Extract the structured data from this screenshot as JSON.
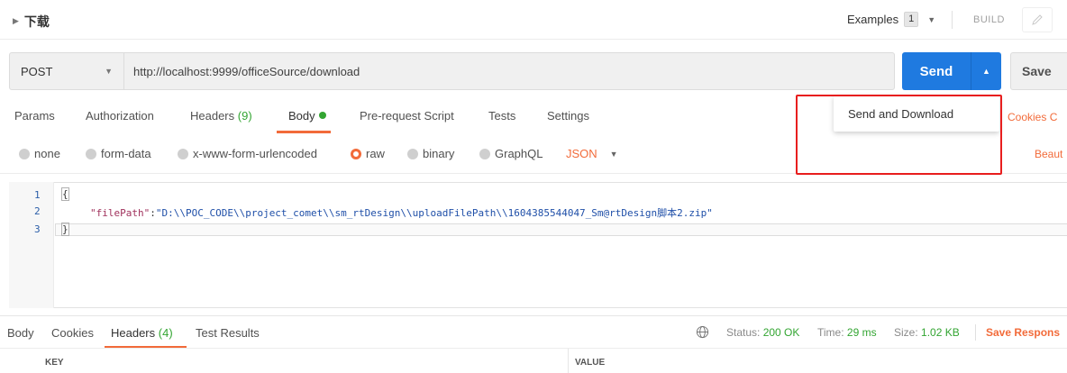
{
  "request": {
    "title": "下载"
  },
  "examples": {
    "label": "Examples",
    "count": "1"
  },
  "build_label": "BUILD",
  "method": "POST",
  "url": "http://localhost:9999/officeSource/download",
  "send_label": "Send",
  "save_label": "Save",
  "send_menu": {
    "item": "Send and Download"
  },
  "tabs": {
    "params": "Params",
    "authorization": "Authorization",
    "headers": "Headers",
    "headers_count": "(9)",
    "body": "Body",
    "prerequest": "Pre-request Script",
    "tests": "Tests",
    "settings": "Settings",
    "cookies": "Cookies C"
  },
  "body_types": {
    "none": "none",
    "form_data": "form-data",
    "urlencoded": "x-www-form-urlencoded",
    "raw": "raw",
    "binary": "binary",
    "graphql": "GraphQL",
    "format": "JSON",
    "beautify": "Beaut"
  },
  "editor": {
    "lines": [
      "1",
      "2",
      "3"
    ],
    "open_brace": "{",
    "key": "\"filePath\"",
    "colon": ":",
    "value": "\"D:\\\\POC_CODE\\\\project_comet\\\\sm_rtDesign\\\\uploadFilePath\\\\1604385544047_Sm@rtDesign脚本2.zip\"",
    "close_brace": "}"
  },
  "response": {
    "tabs": {
      "body": "Body",
      "cookies": "Cookies",
      "headers": "Headers",
      "headers_count": "(4)",
      "test_results": "Test Results"
    },
    "status_label": "Status:",
    "status_value": "200 OK",
    "time_label": "Time:",
    "time_value": "29 ms",
    "size_label": "Size:",
    "size_value": "1.02 KB",
    "save_response": "Save Respons",
    "col_key": "KEY",
    "col_value": "VALUE"
  },
  "colors": {
    "accent": "#f26b3a",
    "primary": "#1f7ae0",
    "success": "#33a532",
    "highlight_box": "#e81e1e"
  }
}
